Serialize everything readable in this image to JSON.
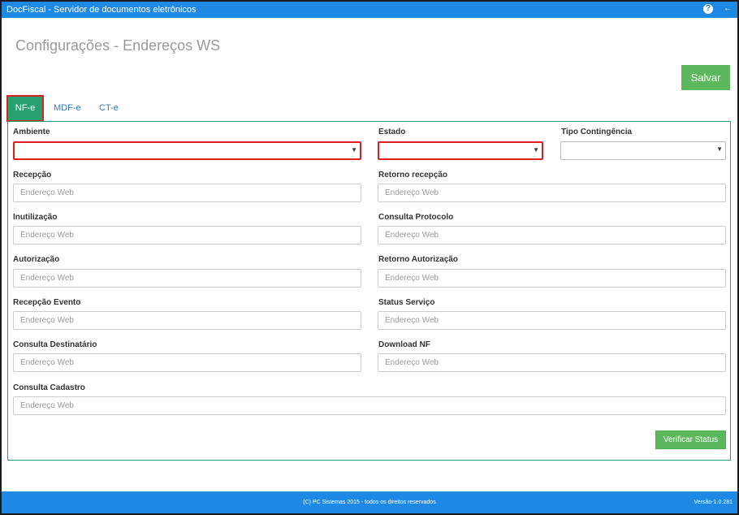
{
  "window": {
    "title": "DocFiscal - Servidor de documentos eletrônicos",
    "help_icon": "question-icon",
    "back_icon": "arrow-left-icon"
  },
  "page": {
    "title": "Configurações - Endereços WS",
    "save_label": "Salvar"
  },
  "tabs": [
    {
      "label": "NF-e",
      "active": true
    },
    {
      "label": "MDF-e",
      "active": false
    },
    {
      "label": "CT-e",
      "active": false
    }
  ],
  "form": {
    "ambiente": {
      "label": "Ambiente",
      "value": ""
    },
    "estado": {
      "label": "Estado",
      "value": ""
    },
    "tipo_contingencia": {
      "label": "Tipo Contingência",
      "value": ""
    },
    "placeholder": "Endereço Web",
    "fields": {
      "recepcao": "Recepção",
      "retorno_recepcao": "Retorno recepção",
      "inutilizacao": "Inutilização",
      "consulta_protocolo": "Consulta Protocolo",
      "autorizacao": "Autorização",
      "retorno_autorizacao": "Retorno Autorização",
      "recepcao_evento": "Recepção Evento",
      "status_servico": "Status Serviço",
      "consulta_destinatario": "Consulta Destinatário",
      "download_nf": "Download NF",
      "consulta_cadastro": "Consulta Cadastro"
    },
    "verify_label": "Verificar Status"
  },
  "footer": {
    "copyright": "(C) PC Sistemas 2015 - todos os direitos reservados",
    "version": "Versão-1.0.281"
  },
  "colors": {
    "topbar": "#1e88e5",
    "tab_active": "#26a16f",
    "button": "#5cb85c",
    "highlight": "#e02020"
  }
}
